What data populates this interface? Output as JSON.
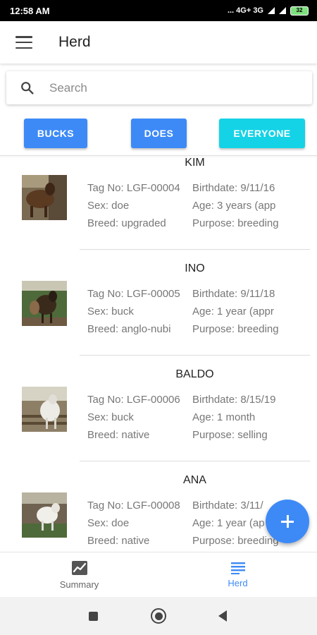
{
  "status_bar": {
    "time": "12:58 AM",
    "indicators": "... 4G+ 3G",
    "battery": "32"
  },
  "app_bar": {
    "title": "Herd",
    "menu_icon": "menu-icon"
  },
  "search": {
    "placeholder": "Search",
    "value": ""
  },
  "filters": {
    "bucks": "BUCKS",
    "does": "DOES",
    "everyone": "EVERYONE"
  },
  "goats": [
    {
      "name": "KIM",
      "tag": "Tag No: LGF-00004",
      "birthdate": "Birthdate: 9/11/16",
      "sex": "Sex: doe",
      "age": "Age: 3 years (app",
      "breed": "Breed: upgraded",
      "purpose": "Purpose: breeding"
    },
    {
      "name": "INO",
      "tag": "Tag No: LGF-00005",
      "birthdate": "Birthdate: 9/11/18",
      "sex": "Sex: buck",
      "age": "Age: 1 year (appr",
      "breed": "Breed: anglo-nubi",
      "purpose": "Purpose: breeding"
    },
    {
      "name": "BALDO",
      "tag": "Tag No: LGF-00006",
      "birthdate": "Birthdate: 8/15/19",
      "sex": "Sex: buck",
      "age": "Age: 1 month",
      "breed": "Breed: native",
      "purpose": "Purpose: selling"
    },
    {
      "name": "ANA",
      "tag": "Tag No: LGF-00008",
      "birthdate": "Birthdate: 3/11/",
      "sex": "Sex: doe",
      "age": "Age: 1 year (ap",
      "breed": "Breed: native",
      "purpose": "Purpose: breeding"
    }
  ],
  "fab": {
    "icon": "plus-icon"
  },
  "bottom_nav": {
    "summary_label": "Summary",
    "herd_label": "Herd"
  },
  "colors": {
    "primary": "#3d8af7",
    "accent_cyan": "#14d3e6",
    "text_muted": "#777777"
  }
}
